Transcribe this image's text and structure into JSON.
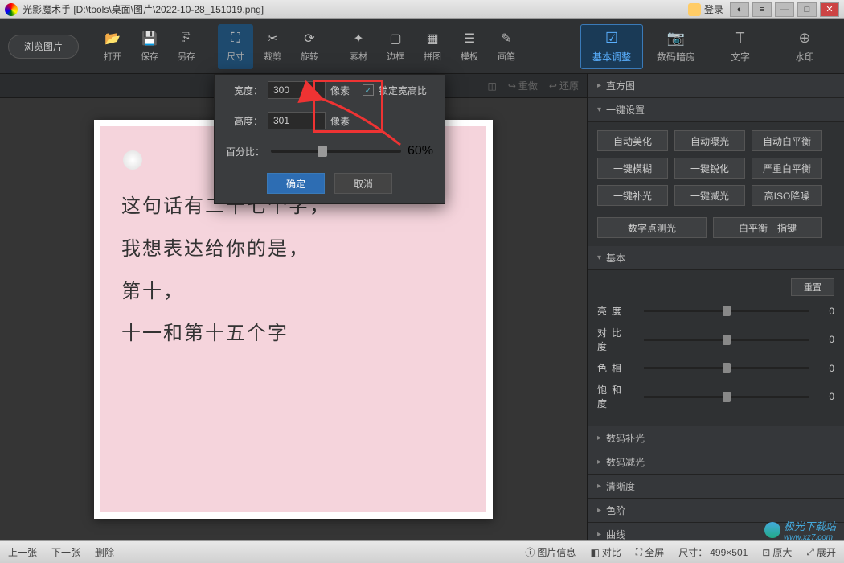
{
  "title": "光影魔术手  [D:\\tools\\桌面\\图片\\2022-10-28_151019.png]",
  "login": "登录",
  "browse": "浏览图片",
  "tools": {
    "open": "打开",
    "save": "保存",
    "saveas": "另存",
    "size": "尺寸",
    "crop": "裁剪",
    "rotate": "旋转",
    "material": "素材",
    "border": "边框",
    "puzzle": "拼图",
    "template": "模板",
    "brush": "画笔"
  },
  "rtabs": {
    "basic": "基本调整",
    "darkroom": "数码暗房",
    "text": "文字",
    "watermark": "水印"
  },
  "subbar": {
    "redo": "重做",
    "undo": "还原"
  },
  "popup": {
    "width_label": "宽度：",
    "width_value": "300",
    "height_label": "高度：",
    "height_value": "301",
    "unit": "像素",
    "lock": "锁定宽高比",
    "percent_label": "百分比：",
    "percent_value": "60%",
    "ok": "确定",
    "cancel": "取消"
  },
  "canvas": {
    "line1": "这句话有二十七个字，",
    "line2": "我想表达给你的是，",
    "line3": "第十，",
    "line4": "十一和第十五个字"
  },
  "panel": {
    "histogram": "直方图",
    "oneclick": "一键设置",
    "buttons": [
      "自动美化",
      "自动曝光",
      "自动白平衡",
      "一键模糊",
      "一键锐化",
      "严重白平衡",
      "一键补光",
      "一键减光",
      "高ISO降噪"
    ],
    "buttons2": [
      "数字点测光",
      "白平衡一指键"
    ],
    "basic": "基本",
    "reset": "重置",
    "sliders": [
      {
        "label": "亮度",
        "value": "0"
      },
      {
        "label": "对比度",
        "value": "0"
      },
      {
        "label": "色相",
        "value": "0"
      },
      {
        "label": "饱和度",
        "value": "0"
      }
    ],
    "sections": [
      "数码补光",
      "数码减光",
      "清晰度",
      "色阶",
      "曲线"
    ]
  },
  "bottom": {
    "prev": "上一张",
    "next": "下一张",
    "delete": "删除",
    "info": "图片信息",
    "compare": "对比",
    "fullscreen": "全屏",
    "dims_label": "尺寸：",
    "dims": "499×501",
    "orig": "原大",
    "expand": "展开"
  },
  "watermark_text": "极光下载站",
  "watermark_url": "www.xz7.com"
}
